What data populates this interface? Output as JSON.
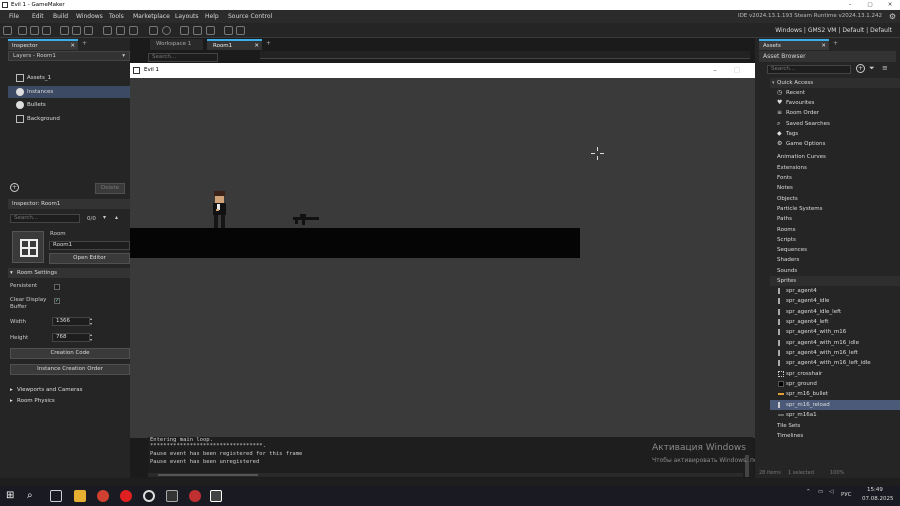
{
  "titlebar": {
    "title": "Evil 1 - GameMaker"
  },
  "menu": {
    "items": [
      "File",
      "Edit",
      "Build",
      "Windows",
      "Tools",
      "Marketplace",
      "Layouts",
      "Help",
      "Source Control"
    ],
    "ide_info": "IDE v2024.13.1.193 Steam  Runtime v2024.13.1.242"
  },
  "toolbar": {
    "target": "Windows | GMS2 VM | Default | Default"
  },
  "left": {
    "inspector_tab": "Inspector",
    "layers_dropdown": "Layers - Room1",
    "layers": [
      "Assets_1",
      "Instances",
      "Bullets",
      "Background"
    ],
    "delete_button": "Delete",
    "inspector_header": "Inspector: Room1",
    "search_placeholder": "Search...",
    "search_count": "0/0",
    "room_label": "Room",
    "room_name": "Room1",
    "open_editor": "Open Editor",
    "room_settings": "Room Settings",
    "persistent": "Persistent",
    "clear_display": "Clear Display",
    "buffer": "Buffer",
    "width_label": "Width",
    "width_value": "1366",
    "height_label": "Height",
    "height_value": "768",
    "creation_code": "Creation Code",
    "instance_order": "Instance Creation Order",
    "viewports": "Viewports and Cameras",
    "physics": "Room Physics"
  },
  "center": {
    "tabs": [
      "Workspace 1",
      "Room1"
    ],
    "search_placeholder": "Search...",
    "game_title": "Evil 1",
    "output_lines": [
      "Entering main loop.",
      "**********************************.",
      "Pause event has been registered for this frame",
      "Pause event has been unregistered"
    ]
  },
  "activation": {
    "line1": "Активация Windows",
    "line2": "Чтобы активировать Windows, перейдите в раздел \"Параметры\"."
  },
  "right": {
    "tab": "Assets",
    "browser_title": "Asset Browser",
    "search_placeholder": "Search...",
    "quick_access": "Quick Access",
    "quick_items": [
      "Recent",
      "Favourites",
      "Room Order",
      "Saved Searches",
      "Tags",
      "Game Options"
    ],
    "groups": [
      "Animation Curves",
      "Extensions",
      "Fonts",
      "Notes",
      "Objects",
      "Particle Systems",
      "Paths",
      "Rooms",
      "Scripts",
      "Sequences",
      "Shaders",
      "Sounds"
    ],
    "sprites_group": "Sprites",
    "sprites": [
      "spr_agent4",
      "spr_agent4_idle",
      "spr_agent4_idle_left",
      "spr_agent4_left",
      "spr_agent4_with_m16",
      "spr_agent4_with_m16_idle",
      "spr_agent4_with_m16_left",
      "spr_agent4_with_m16_left_idle",
      "spr_crosshair",
      "spr_ground",
      "spr_m16_bullet",
      "spr_m16_reload",
      "spr_m16a1"
    ],
    "selected_sprite": "spr_m16_reload",
    "tail_groups": [
      "Tile Sets",
      "Timelines"
    ],
    "footer_items": "28 items",
    "footer_selected": "1 selected",
    "footer_zoom": "100%"
  },
  "taskbar": {
    "lang": "РУС",
    "time": "15:49",
    "date": "07.08.2025"
  },
  "colors": {
    "accent": "#3daee9",
    "selection": "#4b5a78"
  }
}
